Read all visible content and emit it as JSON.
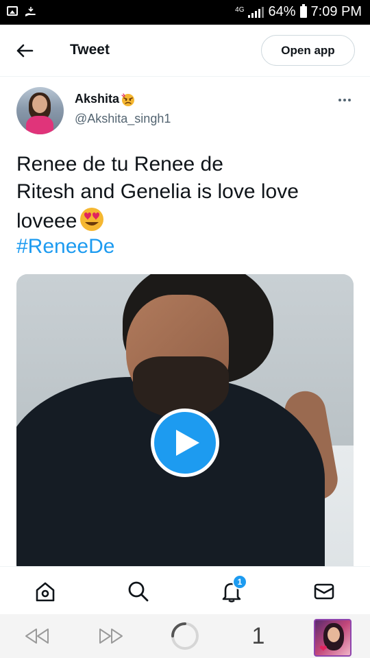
{
  "status_bar": {
    "network": "4G",
    "battery": "64%",
    "time": "7:09 PM",
    "left_icons": [
      "image-icon",
      "download-hand-icon"
    ]
  },
  "header": {
    "back_icon": "arrow-left-icon",
    "title": "Tweet",
    "open_app_label": "Open app"
  },
  "tweet": {
    "author": {
      "name": "Akshita",
      "name_emoji": "angry-face-emoji",
      "handle": "@Akshita_singh1"
    },
    "text_lines": [
      "Renee de tu Renee de",
      "Ritesh and Genelia is love love",
      "loveee"
    ],
    "text_emoji": "heart-eyes-emoji",
    "hashtag": "#ReneeDe",
    "media": {
      "type": "video",
      "play_icon": "play-icon"
    },
    "more_icon": "more-horizontal-icon"
  },
  "bottom_nav": {
    "items": [
      "home-icon",
      "search-icon",
      "notifications-icon",
      "messages-icon"
    ],
    "notifications_badge": "1",
    "accent": "#1d9bf0"
  },
  "browser_bar": {
    "back_icon": "rewind-icon",
    "forward_icon": "fast-forward-icon",
    "loading_icon": "loading-spinner-icon",
    "tab_count": "1",
    "tab_thumbnail": "tab-preview-thumbnail"
  },
  "colors": {
    "link": "#1d9bf0",
    "text_primary": "#0f1419",
    "text_secondary": "#536471"
  }
}
